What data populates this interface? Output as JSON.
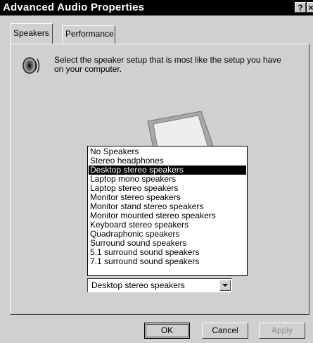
{
  "window": {
    "title": "Advanced Audio Properties",
    "help_button": "?",
    "close_button": "×"
  },
  "tabs": [
    {
      "label": "Speakers",
      "active": true
    },
    {
      "label": "Performance",
      "active": false
    }
  ],
  "speakers": {
    "intro_text": "Select the speaker setup that is most like the setup you have on your computer.",
    "icon": "speaker-icon",
    "options": [
      "No Speakers",
      "Stereo headphones",
      "Desktop stereo speakers",
      "Laptop mono speakers",
      "Laptop stereo speakers",
      "Monitor stereo speakers",
      "Monitor stand stereo speakers",
      "Monitor mounted stereo speakers",
      "Keyboard stereo speakers",
      "Quadraphonic speakers",
      "Surround sound speakers",
      "5.1 surround sound speakers",
      "7.1 surround sound speakers"
    ],
    "highlighted_option_index": 2,
    "selected_value": "Desktop stereo speakers"
  },
  "buttons": {
    "ok": "OK",
    "cancel": "Cancel",
    "apply": "Apply"
  },
  "colors": {
    "title_bar": "#000000",
    "dialog_face": "#d0d0d0",
    "selection": "#000000"
  }
}
